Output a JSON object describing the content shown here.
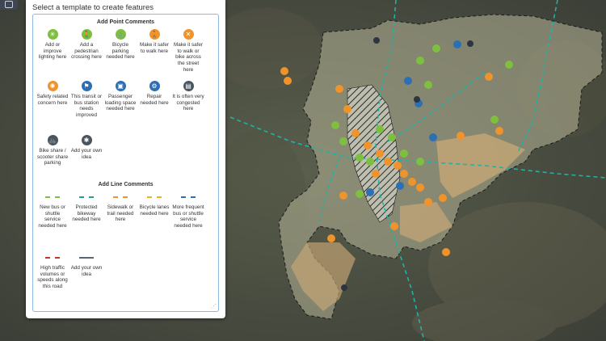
{
  "panel": {
    "title": "Select a template to create features"
  },
  "point_section": {
    "title": "Add Point Comments",
    "items": [
      {
        "label": "Add or improve lighting here",
        "icon": "lighting-icon",
        "glyph": "✳",
        "color": "#7fbf3f"
      },
      {
        "label": "Add a pedestrian crossing here",
        "icon": "pedestrian-icon",
        "glyph": "🚶",
        "color": "#7fbf3f"
      },
      {
        "label": "Bicycle parking needed here",
        "icon": "bicycle-icon",
        "glyph": "🚲",
        "color": "#7fbf3f"
      },
      {
        "label": "Make it safer to walk here",
        "icon": "walk-icon",
        "glyph": "🚶",
        "color": "#f0932b"
      },
      {
        "label": "Make it safer to walk or bike across the street here",
        "icon": "cross-icon",
        "glyph": "✕",
        "color": "#f0932b"
      },
      {
        "label": "Safety related concern here",
        "icon": "safety-icon",
        "glyph": "✺",
        "color": "#f0932b"
      },
      {
        "label": "This transit or bus station needs improved",
        "icon": "bus-stop-icon",
        "glyph": "⚑",
        "color": "#2d6fb3"
      },
      {
        "label": "Passenger loading space needed here",
        "icon": "loading-icon",
        "glyph": "▣",
        "color": "#2d6fb3"
      },
      {
        "label": "Repair needed here",
        "icon": "repair-gear-icon",
        "glyph": "⚙",
        "color": "#2d6fb3"
      },
      {
        "label": "It is often very congested here",
        "icon": "congestion-icon",
        "glyph": "▤",
        "color": "#4a5560"
      },
      {
        "label": "Bike share / scooter share parking",
        "icon": "bike-share-icon",
        "glyph": "🚲",
        "color": "#4a5560"
      },
      {
        "label": "Add your own idea",
        "icon": "own-idea-icon",
        "glyph": "✱",
        "color": "#4a5560"
      }
    ]
  },
  "line_section": {
    "title": "Add Line Comments",
    "items": [
      {
        "label": "New bus or shuttle service needed here",
        "color": "#7fbf3f",
        "style": "dashed"
      },
      {
        "label": "Protected bikeway needed here",
        "color": "#2a9d8f",
        "style": "dashed"
      },
      {
        "label": "Sidewalk or trail needed here",
        "color": "#f0932b",
        "style": "dashed"
      },
      {
        "label": "Bicycle lanes needed here",
        "color": "#f0b020",
        "style": "dashed"
      },
      {
        "label": "More frequent bus or shuttle service needed here",
        "color": "#2d6fb3",
        "style": "dashed"
      },
      {
        "label": "High traffic volumes or speeds along this road",
        "color": "#c0392b",
        "style": "dashed"
      },
      {
        "label": "Add your own idea",
        "color": "#5a6670",
        "style": "solid"
      }
    ]
  },
  "colors": {
    "accent_teal": "#1fb3a6",
    "green": "#7fbf3f",
    "orange": "#f0932b",
    "blue": "#2d6fb3"
  }
}
